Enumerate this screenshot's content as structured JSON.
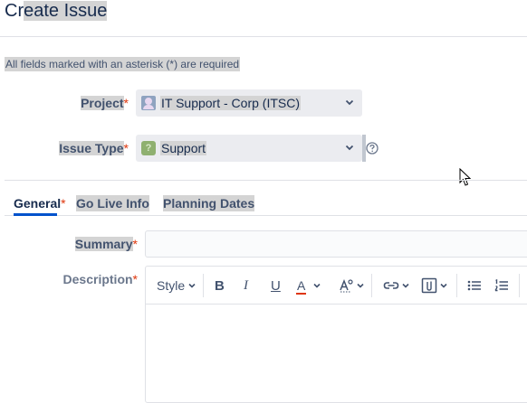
{
  "header": {
    "title": "Create Issue",
    "title_lead": "Cr",
    "title_rest": "eate Issue"
  },
  "form": {
    "required_note": "All fields marked with an asterisk (*) are required",
    "project": {
      "label": "Project",
      "asterisk": "*",
      "value": "IT Support - Corp (ITSC)",
      "icon": "project-avatar-icon"
    },
    "issue_type": {
      "label": "Issue Type",
      "asterisk": "*",
      "value": "Support",
      "icon": "support-type-icon",
      "help_icon": "help-icon"
    },
    "tabs": [
      {
        "label": "General",
        "asterisk": "*",
        "active": true
      },
      {
        "label": "Go Live Info",
        "active": false
      },
      {
        "label": "Planning Dates",
        "active": false
      }
    ],
    "summary": {
      "label": "Summary",
      "asterisk": "*",
      "value": ""
    },
    "description": {
      "label": "Description",
      "asterisk": "*",
      "toolbar": {
        "style_label": "Style",
        "bold": "B",
        "italic": "I",
        "underline": "U",
        "text_color": "A",
        "icons": [
          "bold-icon",
          "italic-icon",
          "underline-icon",
          "text-color-icon",
          "text-effects-icon",
          "link-icon",
          "attachment-icon",
          "bullet-list-icon",
          "numbered-list-icon"
        ]
      }
    }
  },
  "colors": {
    "accent": "#0052cc",
    "required": "#de350b",
    "text": "#172b4d",
    "muted": "#42526e",
    "highlight": "#d4d4d4"
  }
}
